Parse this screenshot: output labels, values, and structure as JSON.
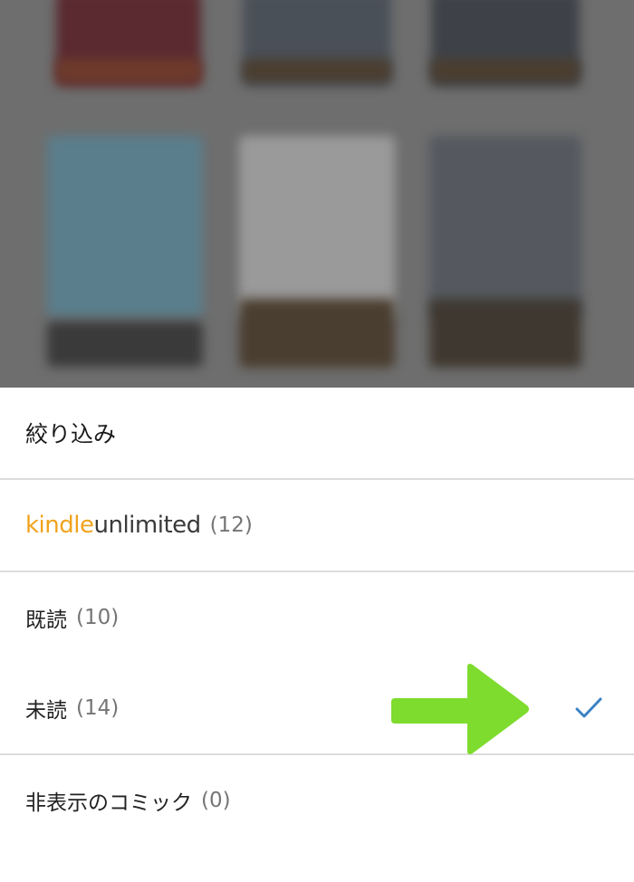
{
  "filter": {
    "title": "絞り込み",
    "kindle_unlimited": {
      "brand_part1": "kindle",
      "brand_part2": "unlimited",
      "count": "(12)"
    },
    "items": [
      {
        "label": "既読",
        "count": "(10)"
      },
      {
        "label": "未読",
        "count": "(14)",
        "selected": true
      },
      {
        "label": "非表示のコミック",
        "count": "(0)"
      }
    ]
  },
  "colors": {
    "kindle_orange": "#f0a31d",
    "check_blue": "#3b82c4",
    "arrow_green": "#7ddc2e"
  },
  "icons": {
    "selected": "checkmark-icon",
    "annotation": "green-arrow-icon"
  }
}
